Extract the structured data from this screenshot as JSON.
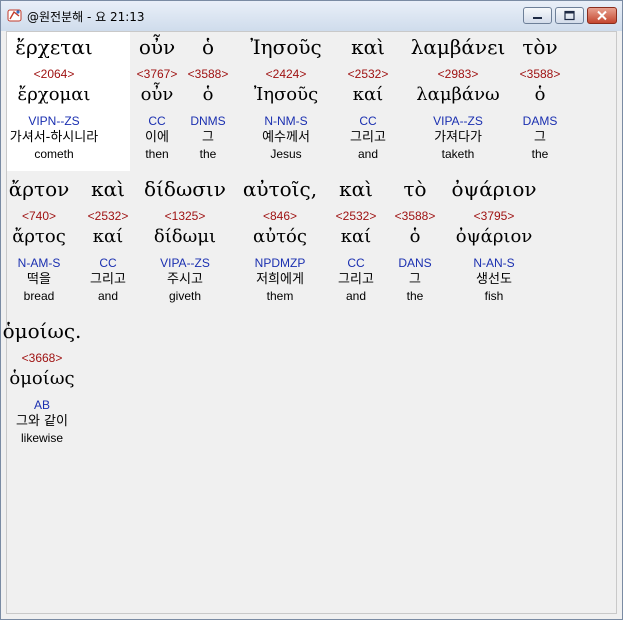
{
  "window": {
    "title": "@원전분해 - 요 21:13",
    "icon": "bible-app-icon",
    "controls": {
      "minimize": "minimize-icon",
      "maximize": "maximize-icon",
      "close": "close-icon"
    }
  },
  "colors": {
    "strongs": "#9e1010",
    "parsing": "#1a2fb0",
    "selection": "#ffffff",
    "background": "#f0f0f0"
  },
  "verse": {
    "reference": "요 21:13",
    "lines": [
      [
        {
          "greek": "ἔρχεται",
          "strongs": "<2064>",
          "lemma": "ἔρχομαι",
          "parsing": "VIPN--ZS",
          "korean": "가셔서-하시니라",
          "english": "cometh",
          "selected": true
        },
        {
          "greek": "οὖν",
          "strongs": "<3767>",
          "lemma": "οὖν",
          "parsing": "CC",
          "korean": "이에",
          "english": "then"
        },
        {
          "greek": "ὁ",
          "strongs": "<3588>",
          "lemma": "ὁ",
          "parsing": "DNMS",
          "korean": "그",
          "english": "the"
        },
        {
          "greek": "Ἰησοῦς",
          "strongs": "<2424>",
          "lemma": "Ἰησοῦς",
          "parsing": "N-NM-S",
          "korean": "예수께서",
          "english": "Jesus"
        },
        {
          "greek": "καὶ",
          "strongs": "<2532>",
          "lemma": "καί",
          "parsing": "CC",
          "korean": "그리고",
          "english": "and"
        },
        {
          "greek": "λαμβάνει",
          "strongs": "<2983>",
          "lemma": "λαμβάνω",
          "parsing": "VIPA--ZS",
          "korean": "가져다가",
          "english": "taketh"
        },
        {
          "greek": "τὸν",
          "strongs": "<3588>",
          "lemma": "ὁ",
          "parsing": "DAMS",
          "korean": "그",
          "english": "the"
        }
      ],
      [
        {
          "greek": "ἄρτον",
          "strongs": "<740>",
          "lemma": "ἄρτος",
          "parsing": "N-AM-S",
          "korean": "떡을",
          "english": "bread"
        },
        {
          "greek": "καὶ",
          "strongs": "<2532>",
          "lemma": "καί",
          "parsing": "CC",
          "korean": "그리고",
          "english": "and"
        },
        {
          "greek": "δίδωσιν",
          "strongs": "<1325>",
          "lemma": "δίδωμι",
          "parsing": "VIPA--ZS",
          "korean": "주시고",
          "english": "giveth"
        },
        {
          "greek": "αὐτοῖς,",
          "strongs": "<846>",
          "lemma": "αὐτός",
          "parsing": "NPDMZP",
          "korean": "저희에게",
          "english": "them"
        },
        {
          "greek": "καὶ",
          "strongs": "<2532>",
          "lemma": "καί",
          "parsing": "CC",
          "korean": "그리고",
          "english": "and"
        },
        {
          "greek": "τὸ",
          "strongs": "<3588>",
          "lemma": "ὁ",
          "parsing": "DANS",
          "korean": "그",
          "english": "the"
        },
        {
          "greek": "ὀψάριον",
          "strongs": "<3795>",
          "lemma": "ὀψάριον",
          "parsing": "N-AN-S",
          "korean": "생선도",
          "english": "fish"
        }
      ],
      [
        {
          "greek": "ὁμοίως.",
          "strongs": "<3668>",
          "lemma": "ὁμοίως",
          "parsing": "AB",
          "korean": "그와 같이",
          "english": "likewise"
        }
      ]
    ]
  }
}
